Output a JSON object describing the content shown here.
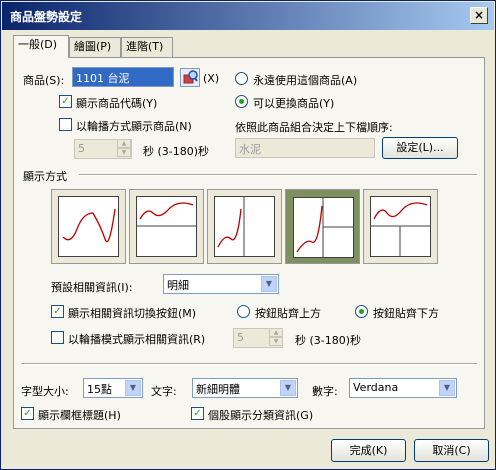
{
  "window": {
    "title": "商品盤勢設定",
    "close": "×"
  },
  "tabs": [
    {
      "label": "一般(D)",
      "active": true
    },
    {
      "label": "繪圖(P)",
      "active": false
    },
    {
      "label": "進階(T)",
      "active": false
    }
  ],
  "product": {
    "label": "商品(S):",
    "value": "1101 台泥",
    "lookup_shortcut": "(X)",
    "show_code_label": "顯示商品代碼(Y)",
    "show_code_checked": true,
    "rotate_label": "以輪播方式顯示商品(N)",
    "rotate_checked": false,
    "seconds_value": "5",
    "seconds_suffix": "秒 (3-180)秒",
    "always_use_label": "永遠使用這個商品(A)",
    "always_use_selected": false,
    "changeable_label": "可以更換商品(Y)",
    "changeable_selected": true,
    "group_order_label": "依照此商品組合決定上下檔順序:",
    "group_value": "水泥",
    "settings_button": "設定(L)..."
  },
  "display": {
    "section_label": "顯示方式",
    "layouts": [
      "single",
      "top-bottom",
      "left-right",
      "left-split-right",
      "top-split-bottom"
    ],
    "selected_layout": 3,
    "default_info_label": "預設相關資訊(I):",
    "default_info_value": "明細",
    "show_switch_label": "顯示相關資訊切換按鈕(M)",
    "show_switch_checked": true,
    "btn_top_label": "按鈕貼齊上方",
    "btn_top_selected": false,
    "btn_bottom_label": "按鈕貼齊下方",
    "btn_bottom_selected": true,
    "rotate_info_label": "以輪播模式顯示相關資訊(R)",
    "rotate_info_checked": false,
    "rotate_info_seconds": "5",
    "rotate_info_suffix": "秒 (3-180)秒"
  },
  "fonts": {
    "size_label": "字型大小:",
    "size_value": "15點",
    "text_label": "文字:",
    "text_value": "新細明體",
    "digits_label": "數字:",
    "digits_value": "Verdana",
    "show_frame_title_label": "顯示欄框標題(H)",
    "show_frame_title_checked": true,
    "category_info_label": "個股顯示分類資訊(G)",
    "category_info_checked": true
  },
  "buttons": {
    "ok": "完成(K)",
    "cancel": "取消(C)"
  },
  "colors": {
    "accent": "#316ac5",
    "check": "#21a121",
    "selected_layout_bg": "#7f8f5f",
    "chart_line": "#c00000"
  }
}
